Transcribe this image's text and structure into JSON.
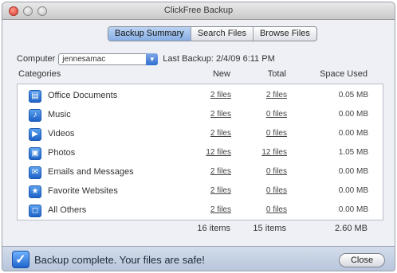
{
  "window": {
    "title": "ClickFree Backup"
  },
  "tabs": [
    {
      "label": "Backup Summary",
      "active": true
    },
    {
      "label": "Search Files",
      "active": false
    },
    {
      "label": "Browse Files",
      "active": false
    }
  ],
  "computer": {
    "label": "Computer",
    "selected": "jennesamac",
    "last_backup": "Last Backup: 2/4/09 6:11 PM"
  },
  "table": {
    "headers": {
      "category": "Categories",
      "new": "New",
      "total": "Total",
      "space": "Space Used"
    },
    "rows": [
      {
        "icon": "office-documents-icon",
        "glyph": "▤",
        "category": "Office Documents",
        "new": "2 files",
        "total": "2 files",
        "space": "0.05 MB"
      },
      {
        "icon": "music-icon",
        "glyph": "♪",
        "category": "Music",
        "new": "2 files",
        "total": "0 files",
        "space": "0.00 MB"
      },
      {
        "icon": "videos-icon",
        "glyph": "▶",
        "category": "Videos",
        "new": "2 files",
        "total": "0 files",
        "space": "0.00 MB"
      },
      {
        "icon": "photos-icon",
        "glyph": "▣",
        "category": "Photos",
        "new": "12 files",
        "total": "12 files",
        "space": "1.05 MB"
      },
      {
        "icon": "emails-icon",
        "glyph": "✉",
        "category": "Emails and Messages",
        "new": "2 files",
        "total": "0 files",
        "space": "0.00 MB"
      },
      {
        "icon": "favorite-websites-icon",
        "glyph": "★",
        "category": "Favorite Websites",
        "new": "2 files",
        "total": "0 files",
        "space": "0.00 MB"
      },
      {
        "icon": "all-others-icon",
        "glyph": "◻",
        "category": "All Others",
        "new": "2 files",
        "total": "0 files",
        "space": "0.00 MB"
      }
    ],
    "totals": {
      "new": "16 items",
      "total": "15 items",
      "space": "2.60 MB"
    }
  },
  "footer": {
    "status": "Backup complete. Your files are safe!",
    "close_label": "Close"
  }
}
